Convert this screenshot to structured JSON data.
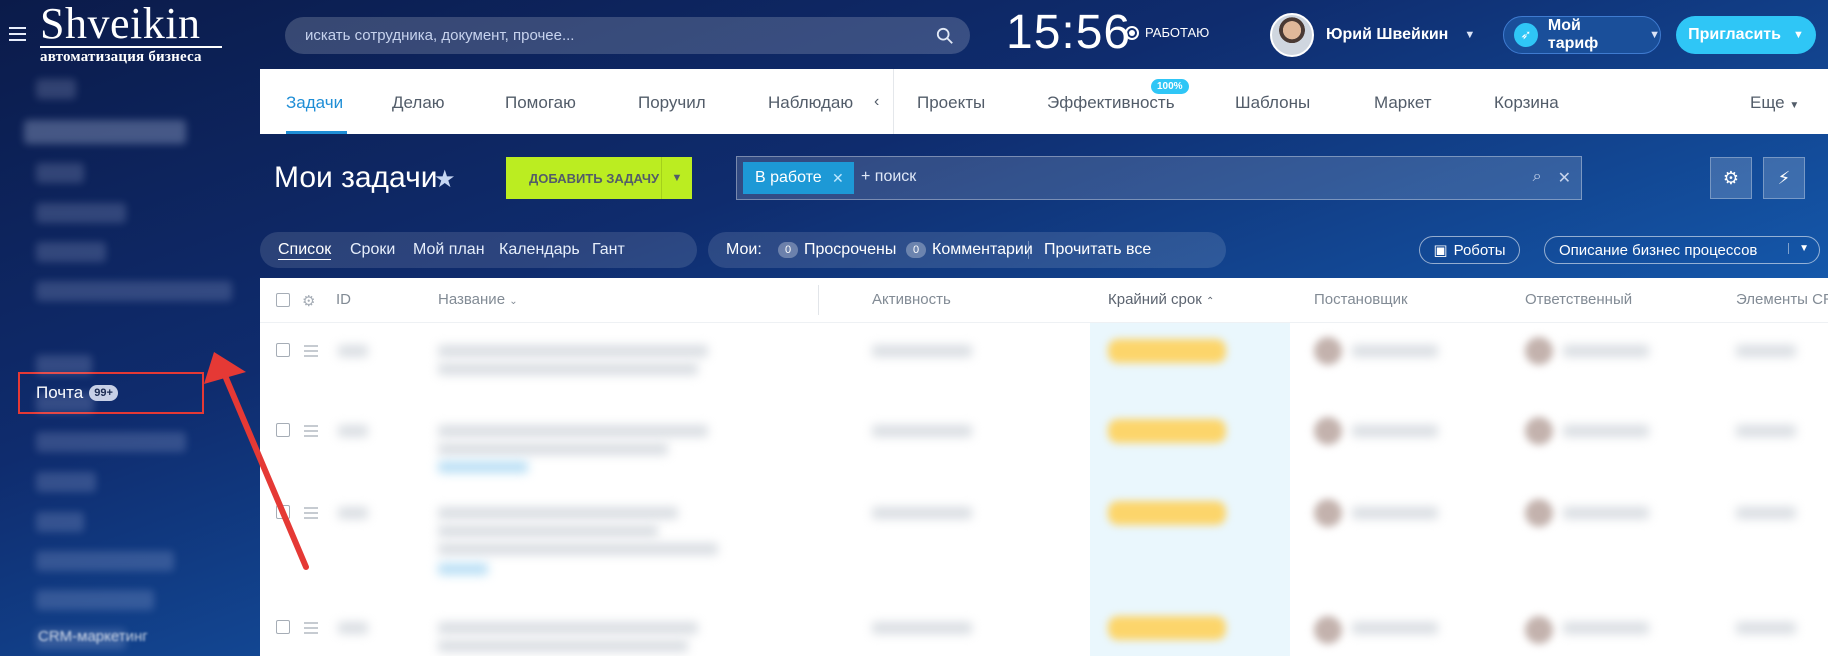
{
  "header": {
    "logo_name": "Shveikin",
    "logo_sub": "автоматизация бизнеса",
    "search_placeholder": "искать сотрудника, документ, прочее...",
    "clock": "15:56",
    "work_status": "РАБОТАЮ",
    "user_name": "Юрий Швейкин",
    "tariff_label": "Мой тариф",
    "invite_label": "Пригласить"
  },
  "sidebar": {
    "mail_label": "Почта",
    "mail_badge": "99+",
    "bottom_label": "CRM-маркетинг"
  },
  "tabs": {
    "items": [
      "Задачи",
      "Делаю",
      "Помогаю",
      "Поручил",
      "Наблюдаю",
      "Проекты",
      "Эффективность",
      "Шаблоны",
      "Маркет",
      "Корзина",
      "Еще"
    ],
    "active": "Задачи",
    "efficiency_badge": "100%"
  },
  "toolbar": {
    "page_title": "Мои задачи",
    "add_task_label": "ДОБАВИТЬ ЗАДАЧУ",
    "filter_tag": "В работе",
    "filter_placeholder": "+ поиск"
  },
  "views": {
    "items": [
      "Список",
      "Сроки",
      "Мой план",
      "Календарь",
      "Гант"
    ],
    "active": "Список"
  },
  "counters": {
    "label": "Мои:",
    "overdue_count": "0",
    "overdue_label": "Просрочены",
    "comments_count": "0",
    "comments_label": "Комментарии",
    "read_all_label": "Прочитать все"
  },
  "actions": {
    "robots_label": "Роботы",
    "bp_label": "Описание бизнес процессов"
  },
  "table": {
    "columns": [
      "ID",
      "Название",
      "Активность",
      "Крайний срок",
      "Постановщик",
      "Ответственный",
      "Элементы CRM"
    ]
  },
  "colors": {
    "accent": "#1f8ed6",
    "add_button": "#bbed21",
    "invite_button": "#2fc6f6",
    "highlight_box": "#e53935",
    "deadline_badge": "#fcd56b"
  }
}
